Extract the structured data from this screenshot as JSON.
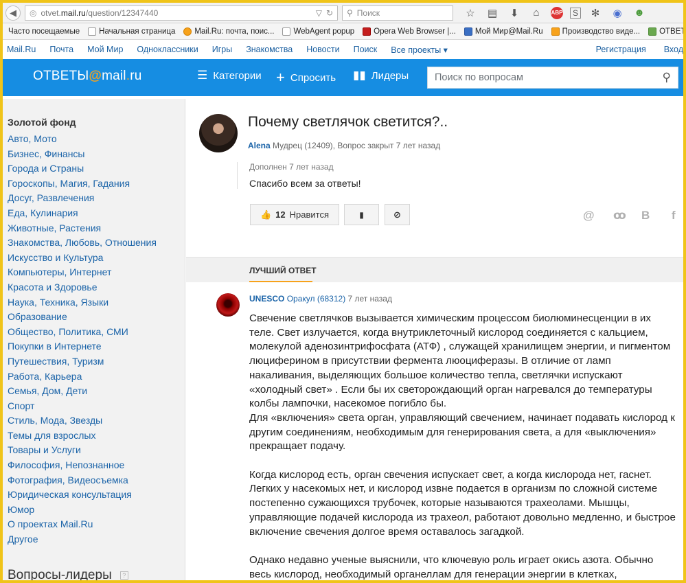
{
  "browser": {
    "url_prefix": "otvet.",
    "url_domain": "mail.ru",
    "url_path": "/question/12347440",
    "search_placeholder": "Поиск",
    "bookmarks": [
      {
        "label": "Часто посещаемые",
        "icon": "page-icon"
      },
      {
        "label": "Начальная страница",
        "icon": "page-icon"
      },
      {
        "label": "Mail.Ru: почта, поис...",
        "icon": "mailru-icon"
      },
      {
        "label": "WebAgent popup",
        "icon": "page-icon"
      },
      {
        "label": "Opera Web Browser |...",
        "icon": "opera-icon"
      },
      {
        "label": "Мой Мир@Mail.Ru",
        "icon": "moymir-icon"
      },
      {
        "label": "Производство виде...",
        "icon": "video-icon"
      },
      {
        "label": "ОТВЕТЫ@Mail",
        "icon": "otvety-icon"
      }
    ]
  },
  "portal": {
    "links": [
      "Mail.Ru",
      "Почта",
      "Мой Мир",
      "Одноклассники",
      "Игры",
      "Знакомства",
      "Новости",
      "Поиск",
      "Все проекты ▾"
    ],
    "register": "Регистрация",
    "login": "Вход"
  },
  "header": {
    "logo_left": "ОТВЕТЫ",
    "logo_at": "@",
    "logo_mail": "mail",
    "logo_dot": ".",
    "logo_ru": "ru",
    "categories": "Категории",
    "ask": "Спросить",
    "leaders": "Лидеры",
    "search_placeholder": "Поиск по вопросам"
  },
  "sidebar": {
    "gold_fund": "Золотой фонд",
    "categories": [
      "Авто, Мото",
      "Бизнес, Финансы",
      "Города и Страны",
      "Гороскопы, Магия, Гадания",
      "Досуг, Развлечения",
      "Еда, Кулинария",
      "Животные, Растения",
      "Знакомства, Любовь, Отношения",
      "Искусство и Культура",
      "Компьютеры, Интернет",
      "Красота и Здоровье",
      "Наука, Техника, Языки",
      "Образование",
      "Общество, Политика, СМИ",
      "Покупки в Интернете",
      "Путешествия, Туризм",
      "Работа, Карьера",
      "Семья, Дом, Дети",
      "Спорт",
      "Стиль, Мода, Звезды",
      "Темы для взрослых",
      "Товары и Услуги",
      "Философия, Непознанное",
      "Фотография, Видеосъемка",
      "Юридическая консультация",
      "Юмор",
      "О проектах Mail.Ru",
      "Другое"
    ],
    "leaders_title": "Вопросы-лидеры",
    "leaders_help": "?"
  },
  "question": {
    "title": "Почему светлячок светится?..",
    "author": "Alena",
    "meta": " Мудрец (12409), Вопрос закрыт 7 лет назад",
    "addendum_label": "Дополнен 7 лет назад",
    "addendum_text": "Спасибо всем за ответы!",
    "likes": "12",
    "like_label": "Нравится"
  },
  "tabs": {
    "best_answer": "ЛУЧШИЙ ОТВЕТ"
  },
  "answer": {
    "author": "UNESCO",
    "rank": "Оракул (68312)",
    "time": " 7 лет назад",
    "paragraphs": [
      "Свечение светлячков вызывается химическим процессом биолюминесценции в их теле. Свет излучается, когда внутриклеточный кислород соединяется с кальцием, молекулой аденозинтрифосфата (АТФ) , служащей хранилищем энергии, и пигментом люциферином в присутствии фермента люоциферазы. В отличие от ламп накаливания, выделяющих большое количество тепла, светлячки испускают «холодный свет» . Если бы их светорождающий орган нагревался до температуры колбы лампочки, насекомое погибло бы.",
      "Для «включения» света орган, управляющий свечением, начинает подавать кислород к другим соединениям, необходимым для генерирования света, а для «выключения» прекращает подачу.",
      "Когда кислород есть, орган свечения испускает свет, а когда кислорода нет, гаснет. Легких у насекомых нет, и кислород извне подается в организм по сложной системе постепенно сужающихся трубочек, которые называются трахеолами. Мышцы, управляющие подачей кислорода из трахеол, работают довольно медленно, и быстрое включение свечения долгое время оставалось загадкой.",
      "Однако недавно ученые выяснили, что ключевую роль играет окись азота. Обычно весь кислород, необходимый органеллам для генерации энергии в клетках,"
    ]
  },
  "colors": {
    "brand_blue": "#168de2",
    "accent_orange": "#f7a21b",
    "frame_yellow": "#f0c419",
    "link_blue": "#1a63a8"
  }
}
